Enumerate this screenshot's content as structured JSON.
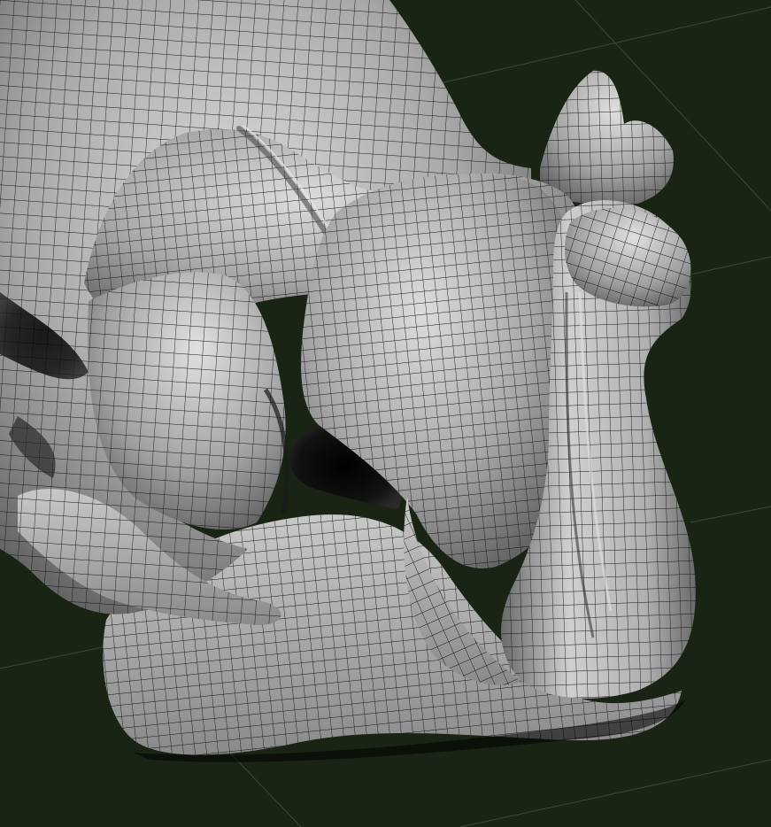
{
  "viewport": {
    "background_color": "#1a2414",
    "grid_color": "#3a4a34",
    "mesh_fill_color": "#a6a6a6",
    "mesh_light_color": "#d8d8d8",
    "mesh_shadow_color": "#5e5e5e",
    "wireframe_color": "#141414",
    "cavity_color": "#050505"
  }
}
